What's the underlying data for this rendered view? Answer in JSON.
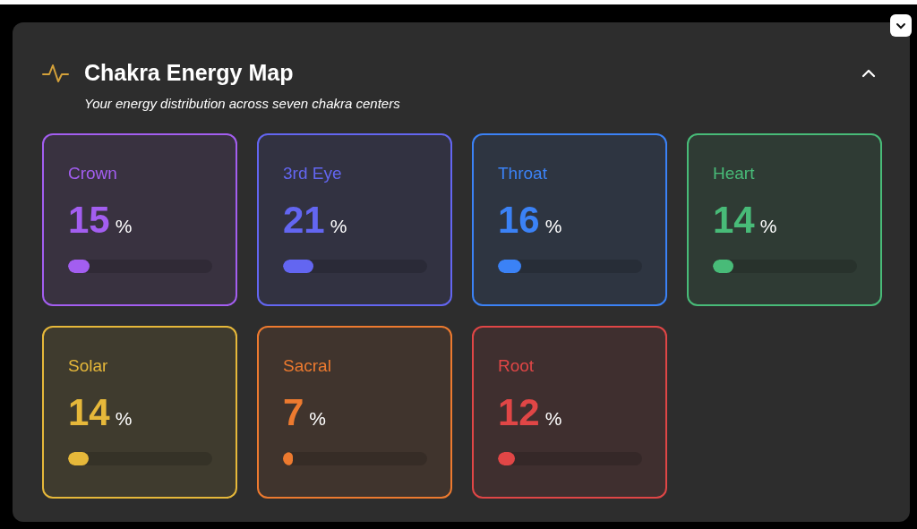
{
  "header": {
    "title": "Chakra Energy Map",
    "subtitle": "Your energy distribution across seven chakra centers",
    "expanded": true
  },
  "chakras": [
    {
      "name": "Crown",
      "value": "15",
      "unit": "%",
      "level": 0.15,
      "color": "#a35ef0"
    },
    {
      "name": "3rd Eye",
      "value": "21",
      "unit": "%",
      "level": 0.21,
      "color": "#6366f1"
    },
    {
      "name": "Throat",
      "value": "16",
      "unit": "%",
      "level": 0.16,
      "color": "#3b82f6"
    },
    {
      "name": "Heart",
      "value": "14",
      "unit": "%",
      "level": 0.14,
      "color": "#48bb78"
    },
    {
      "name": "Solar",
      "value": "14",
      "unit": "%",
      "level": 0.14,
      "color": "#e6b83a"
    },
    {
      "name": "Sacral",
      "value": "7",
      "unit": "%",
      "level": 0.07,
      "color": "#ed7a2f"
    },
    {
      "name": "Root",
      "value": "12",
      "unit": "%",
      "level": 0.12,
      "color": "#e04646"
    }
  ]
}
